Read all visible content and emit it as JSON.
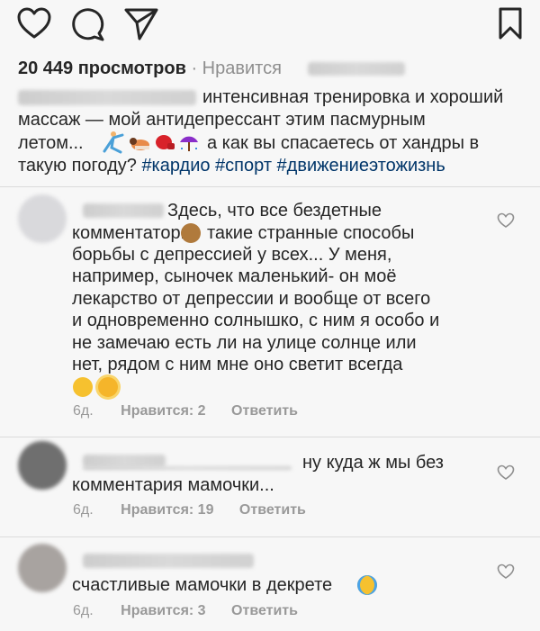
{
  "post": {
    "views": "20 449 просмотров",
    "likes_sep": "·",
    "likes_label": "Нравится",
    "caption_lines": [
      "интенсивная тренировка и хороший",
      "массаж — мой антидепрессант этим пасмурным",
      "летом...",
      "а как вы спасаетесь от хандры в",
      "такую погоду?"
    ],
    "hashtags": "#кардио #спорт #движениеэтожизнь"
  },
  "comments": [
    {
      "lines": [
        "Здесь, что все бездетные",
        "комментаторы",
        "такие странные способы",
        "борьбы с депрессией у всех... У меня,",
        "например, сыночек маленький- он моё",
        "лекарство от депрессии и вообще от всего",
        "и одновременно солнышко, с ним я особо и",
        "не замечаю есть ли на улице солнце или",
        "нет, рядом с ним мне оно светит всегда"
      ],
      "age": "6д.",
      "likes": "Нравится: 2",
      "reply": "Ответить"
    },
    {
      "lines": [
        "ну куда ж мы без",
        "комментария мамочки..."
      ],
      "age": "6д.",
      "likes": "Нравится: 19",
      "reply": "Ответить"
    },
    {
      "lines": [
        "счастливые мамочки в декрете"
      ],
      "age": "6д.",
      "likes": "Нравится: 3",
      "reply": "Ответить"
    }
  ],
  "icons": {
    "like": "heart-icon",
    "comment": "comment-icon",
    "share": "send-icon",
    "save": "bookmark-icon",
    "comment_like": "small-heart-icon"
  },
  "colors": {
    "text": "#262626",
    "hashtag": "#003569",
    "meta": "#999999",
    "background": "#f7f7f7"
  }
}
